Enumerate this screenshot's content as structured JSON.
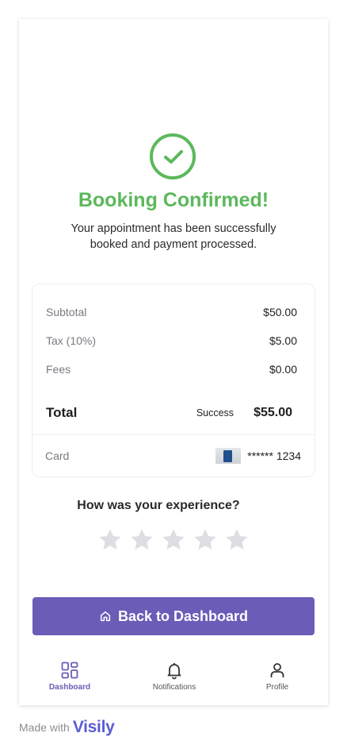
{
  "confirmation": {
    "title": "Booking Confirmed!",
    "message": "Your appointment has been successfully booked and payment processed."
  },
  "summary": {
    "subtotal_label": "Subtotal",
    "subtotal_value": "$50.00",
    "tax_label": "Tax (10%)",
    "tax_value": "$5.00",
    "fees_label": "Fees",
    "fees_value": "$0.00",
    "total_label": "Total",
    "status": "Success",
    "total_value": "$55.00",
    "card_label": "Card",
    "card_icon": "visa-card-icon",
    "card_number": "****** 1234"
  },
  "rating": {
    "question": "How was your experience?",
    "star_count": 5,
    "selected": 0
  },
  "cta": {
    "label": "Back to Dashboard",
    "icon": "home-icon"
  },
  "tabbar": {
    "items": [
      {
        "label": "Dashboard",
        "icon": "grid-icon",
        "active": true
      },
      {
        "label": "Notifications",
        "icon": "bell-icon",
        "active": false
      },
      {
        "label": "Profile",
        "icon": "user-icon",
        "active": false
      }
    ]
  },
  "footer": {
    "made_with": "Made with",
    "brand": "Visily"
  },
  "colors": {
    "success": "#5cb85c",
    "primary": "#6b5cb8",
    "star_empty": "#dcdee3",
    "brand": "#5b5bd6"
  }
}
